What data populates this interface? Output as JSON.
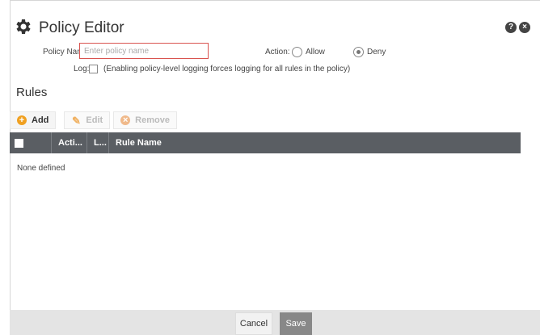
{
  "dialog": {
    "title": "Policy Editor",
    "icons": {
      "title_icon": "gear-icon",
      "help": "?",
      "close": "×"
    }
  },
  "form": {
    "policy_name_label": "Policy Name:",
    "policy_name_value": "",
    "policy_name_placeholder": "Enter policy name",
    "action_label": "Action:",
    "action_options": [
      {
        "label": "Allow",
        "selected": false
      },
      {
        "label": "Deny",
        "selected": true
      }
    ],
    "log_label": "Log:",
    "log_checked": false,
    "log_hint": "(Enabling policy-level logging forces logging for all rules in the policy)"
  },
  "rules": {
    "section_title": "Rules",
    "toolbar": {
      "add_label": "Add",
      "edit_label": "Edit",
      "remove_label": "Remove"
    },
    "columns": [
      "Acti...",
      "L...",
      "Rule Name"
    ],
    "empty_text": "None defined"
  },
  "footer": {
    "cancel_label": "Cancel",
    "save_label": "Save"
  },
  "colors": {
    "header_bg": "#5a5e63",
    "input_border_error": "#d9534f",
    "add_icon": "#f0a020",
    "footer_bg": "#e4e4e4",
    "save_bg": "#888888"
  }
}
